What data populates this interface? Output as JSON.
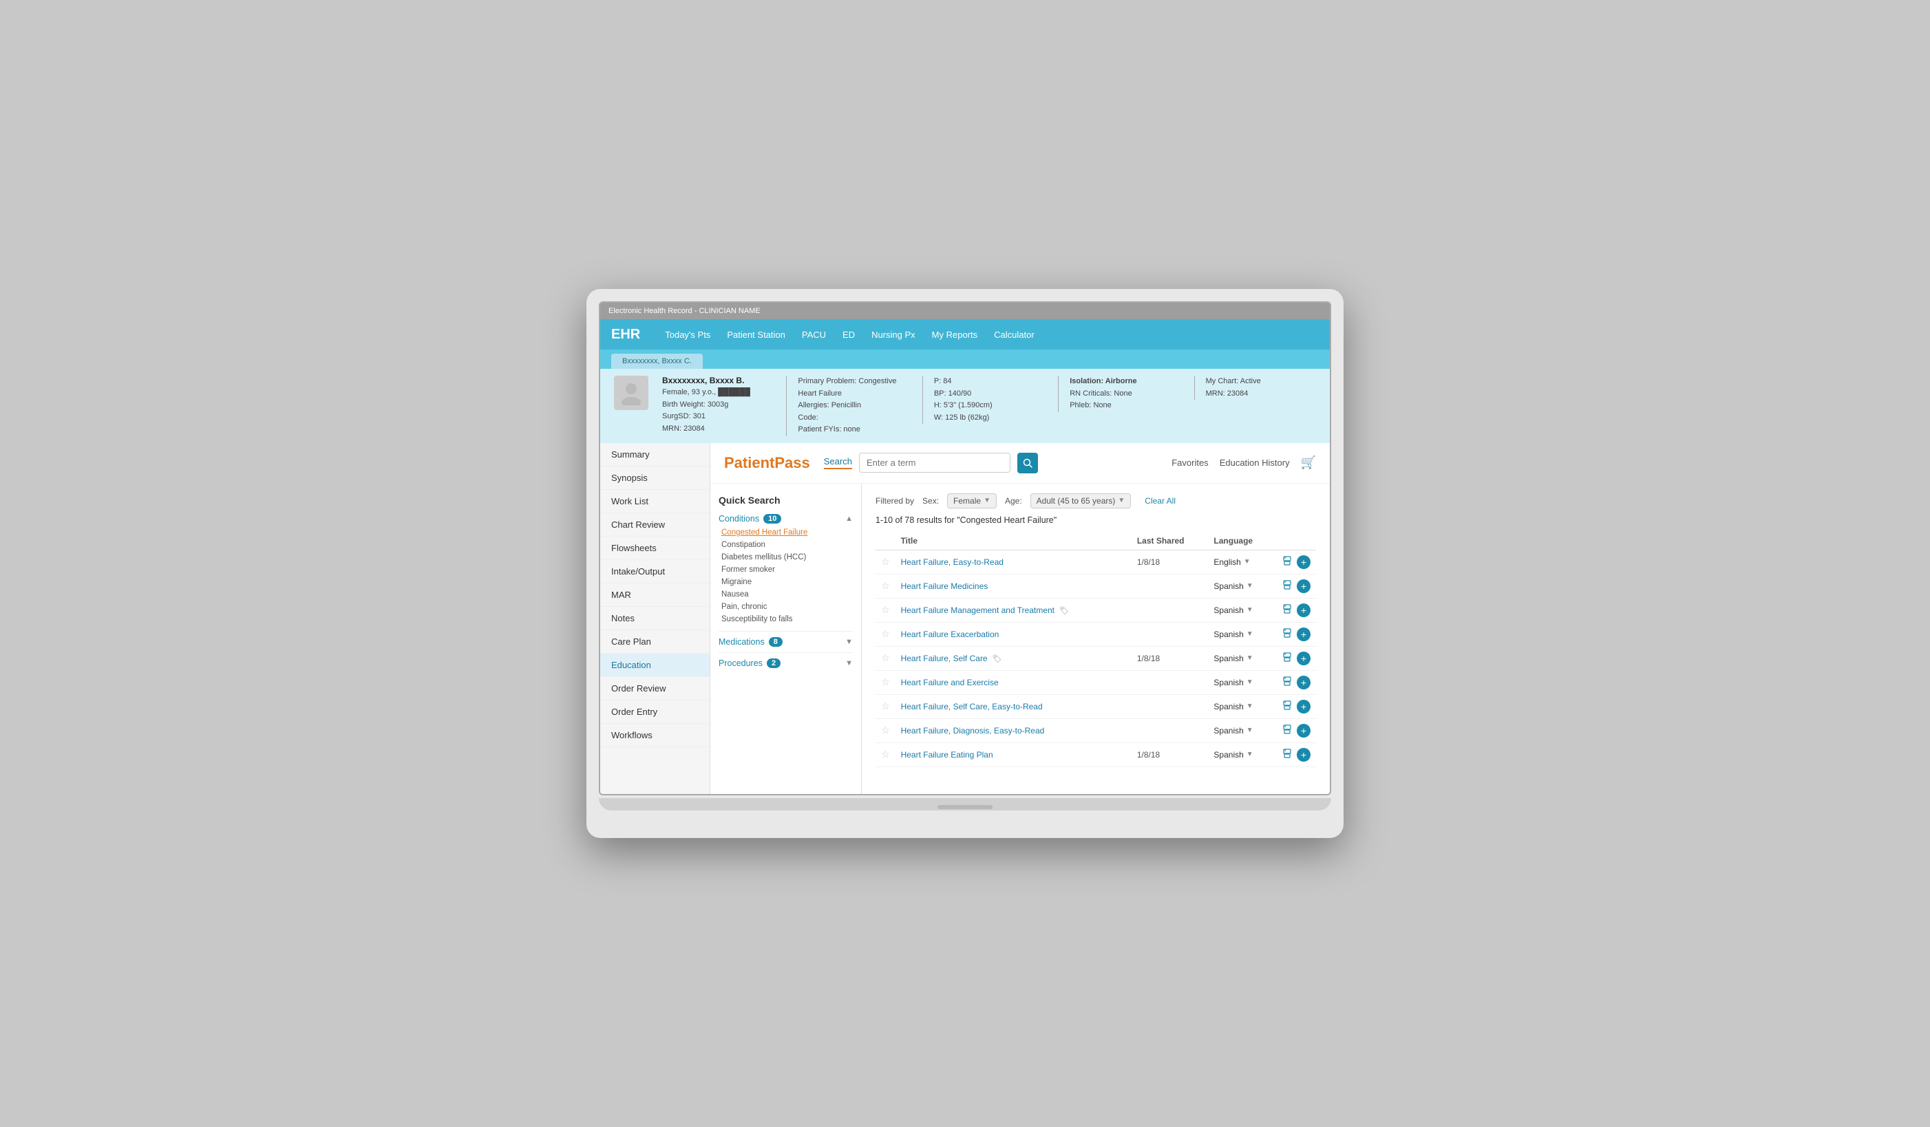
{
  "titleBar": {
    "text": "Electronic Health Record - CLINICIAN NAME"
  },
  "nav": {
    "logo": "EHR",
    "items": [
      {
        "label": "Today's Pts"
      },
      {
        "label": "Patient Station"
      },
      {
        "label": "PACU"
      },
      {
        "label": "ED"
      },
      {
        "label": "Nursing Px"
      },
      {
        "label": "My Reports"
      },
      {
        "label": "Calculator"
      }
    ]
  },
  "patientTab": {
    "label": "Bxxxxxxxx, Bxxxx C."
  },
  "patientHeader": {
    "name": "Bxxxxxxxx, Bxxxx B.",
    "demographics": "Female, 93 y.o.,  ██████",
    "birthWeight": "Birth Weight: 3003g",
    "surgSD": "SurgSD: 301",
    "mrn": "MRN: 23084",
    "primaryProblem": "Primary Problem: Congestive Heart Failure",
    "allergies": "Allergies: Penicillin",
    "code": "Code:",
    "patientFYIs": "Patient FYIs: none",
    "pulse": "P: 84",
    "bp": "BP: 140/90",
    "height": "H: 5'3\" (1.590cm)",
    "weight": "W: 125 lb (62kg)",
    "isolation": "Isolation: Airborne",
    "rnCriticals": "RN Criticals: None",
    "phleb": "Phleb: None",
    "myChart": "My Chart: Active",
    "mrnRight": "MRN: 23084"
  },
  "sidebarNav": {
    "items": [
      {
        "label": "Summary",
        "active": false
      },
      {
        "label": "Synopsis",
        "active": false
      },
      {
        "label": "Work List",
        "active": false
      },
      {
        "label": "Chart Review",
        "active": false
      },
      {
        "label": "Flowsheets",
        "active": false
      },
      {
        "label": "Intake/Output",
        "active": false
      },
      {
        "label": "MAR",
        "active": false
      },
      {
        "label": "Notes",
        "active": false
      },
      {
        "label": "Care Plan",
        "active": false
      },
      {
        "label": "Education",
        "active": true
      },
      {
        "label": "Order Review",
        "active": false
      },
      {
        "label": "Order Entry",
        "active": false
      },
      {
        "label": "Workflows",
        "active": false
      }
    ]
  },
  "patientPass": {
    "logo": "PatientPass",
    "searchLabel": "Search",
    "searchPlaceholder": "Enter a term",
    "favorites": "Favorites",
    "educationHistory": "Education History"
  },
  "quickSearch": {
    "title": "Quick Search",
    "sections": [
      {
        "title": "Conditions",
        "badge": "10",
        "expanded": true,
        "items": [
          {
            "label": "Congested Heart Failure",
            "active": true
          },
          {
            "label": "Constipation",
            "active": false
          },
          {
            "label": "Diabetes mellitus (HCC)",
            "active": false
          },
          {
            "label": "Former smoker",
            "active": false
          },
          {
            "label": "Migraine",
            "active": false
          },
          {
            "label": "Nausea",
            "active": false
          },
          {
            "label": "Pain, chronic",
            "active": false
          },
          {
            "label": "Susceptibility to falls",
            "active": false
          }
        ]
      },
      {
        "title": "Medications",
        "badge": "8",
        "expanded": false,
        "items": []
      },
      {
        "title": "Procedures",
        "badge": "2",
        "expanded": false,
        "items": []
      }
    ]
  },
  "results": {
    "filterLabel": "Filtered by",
    "sexFilter": "Female",
    "ageFilter": "Adult (45 to 65 years)",
    "clearAll": "Clear All",
    "countText": "1-10 of 78 results for",
    "searchTerm": "\"Congested Heart Failure\"",
    "columns": [
      "Title",
      "Last Shared",
      "Language"
    ],
    "rows": [
      {
        "id": 1,
        "title": "Heart Failure, Easy-to-Read",
        "lastShared": "1/8/18",
        "language": "English",
        "starred": false,
        "hasTag": false
      },
      {
        "id": 2,
        "title": "Heart Failure Medicines",
        "lastShared": "",
        "language": "Spanish",
        "starred": false,
        "hasTag": false
      },
      {
        "id": 3,
        "title": "Heart Failure Management and Treatment",
        "lastShared": "",
        "language": "Spanish",
        "starred": false,
        "hasTag": true
      },
      {
        "id": 4,
        "title": "Heart Failure Exacerbation",
        "lastShared": "",
        "language": "Spanish",
        "starred": false,
        "hasTag": false
      },
      {
        "id": 5,
        "title": "Heart Failure, Self Care",
        "lastShared": "1/8/18",
        "language": "Spanish",
        "starred": false,
        "hasTag": true
      },
      {
        "id": 6,
        "title": "Heart Failure and Exercise",
        "lastShared": "",
        "language": "Spanish",
        "starred": false,
        "hasTag": false
      },
      {
        "id": 7,
        "title": "Heart Failure, Self Care, Easy-to-Read",
        "lastShared": "",
        "language": "Spanish",
        "starred": false,
        "hasTag": false
      },
      {
        "id": 8,
        "title": "Heart Failure, Diagnosis, Easy-to-Read",
        "lastShared": "",
        "language": "Spanish",
        "starred": false,
        "hasTag": false
      },
      {
        "id": 9,
        "title": "Heart Failure Eating Plan",
        "lastShared": "1/8/18",
        "language": "Spanish",
        "starred": false,
        "hasTag": false
      }
    ]
  }
}
